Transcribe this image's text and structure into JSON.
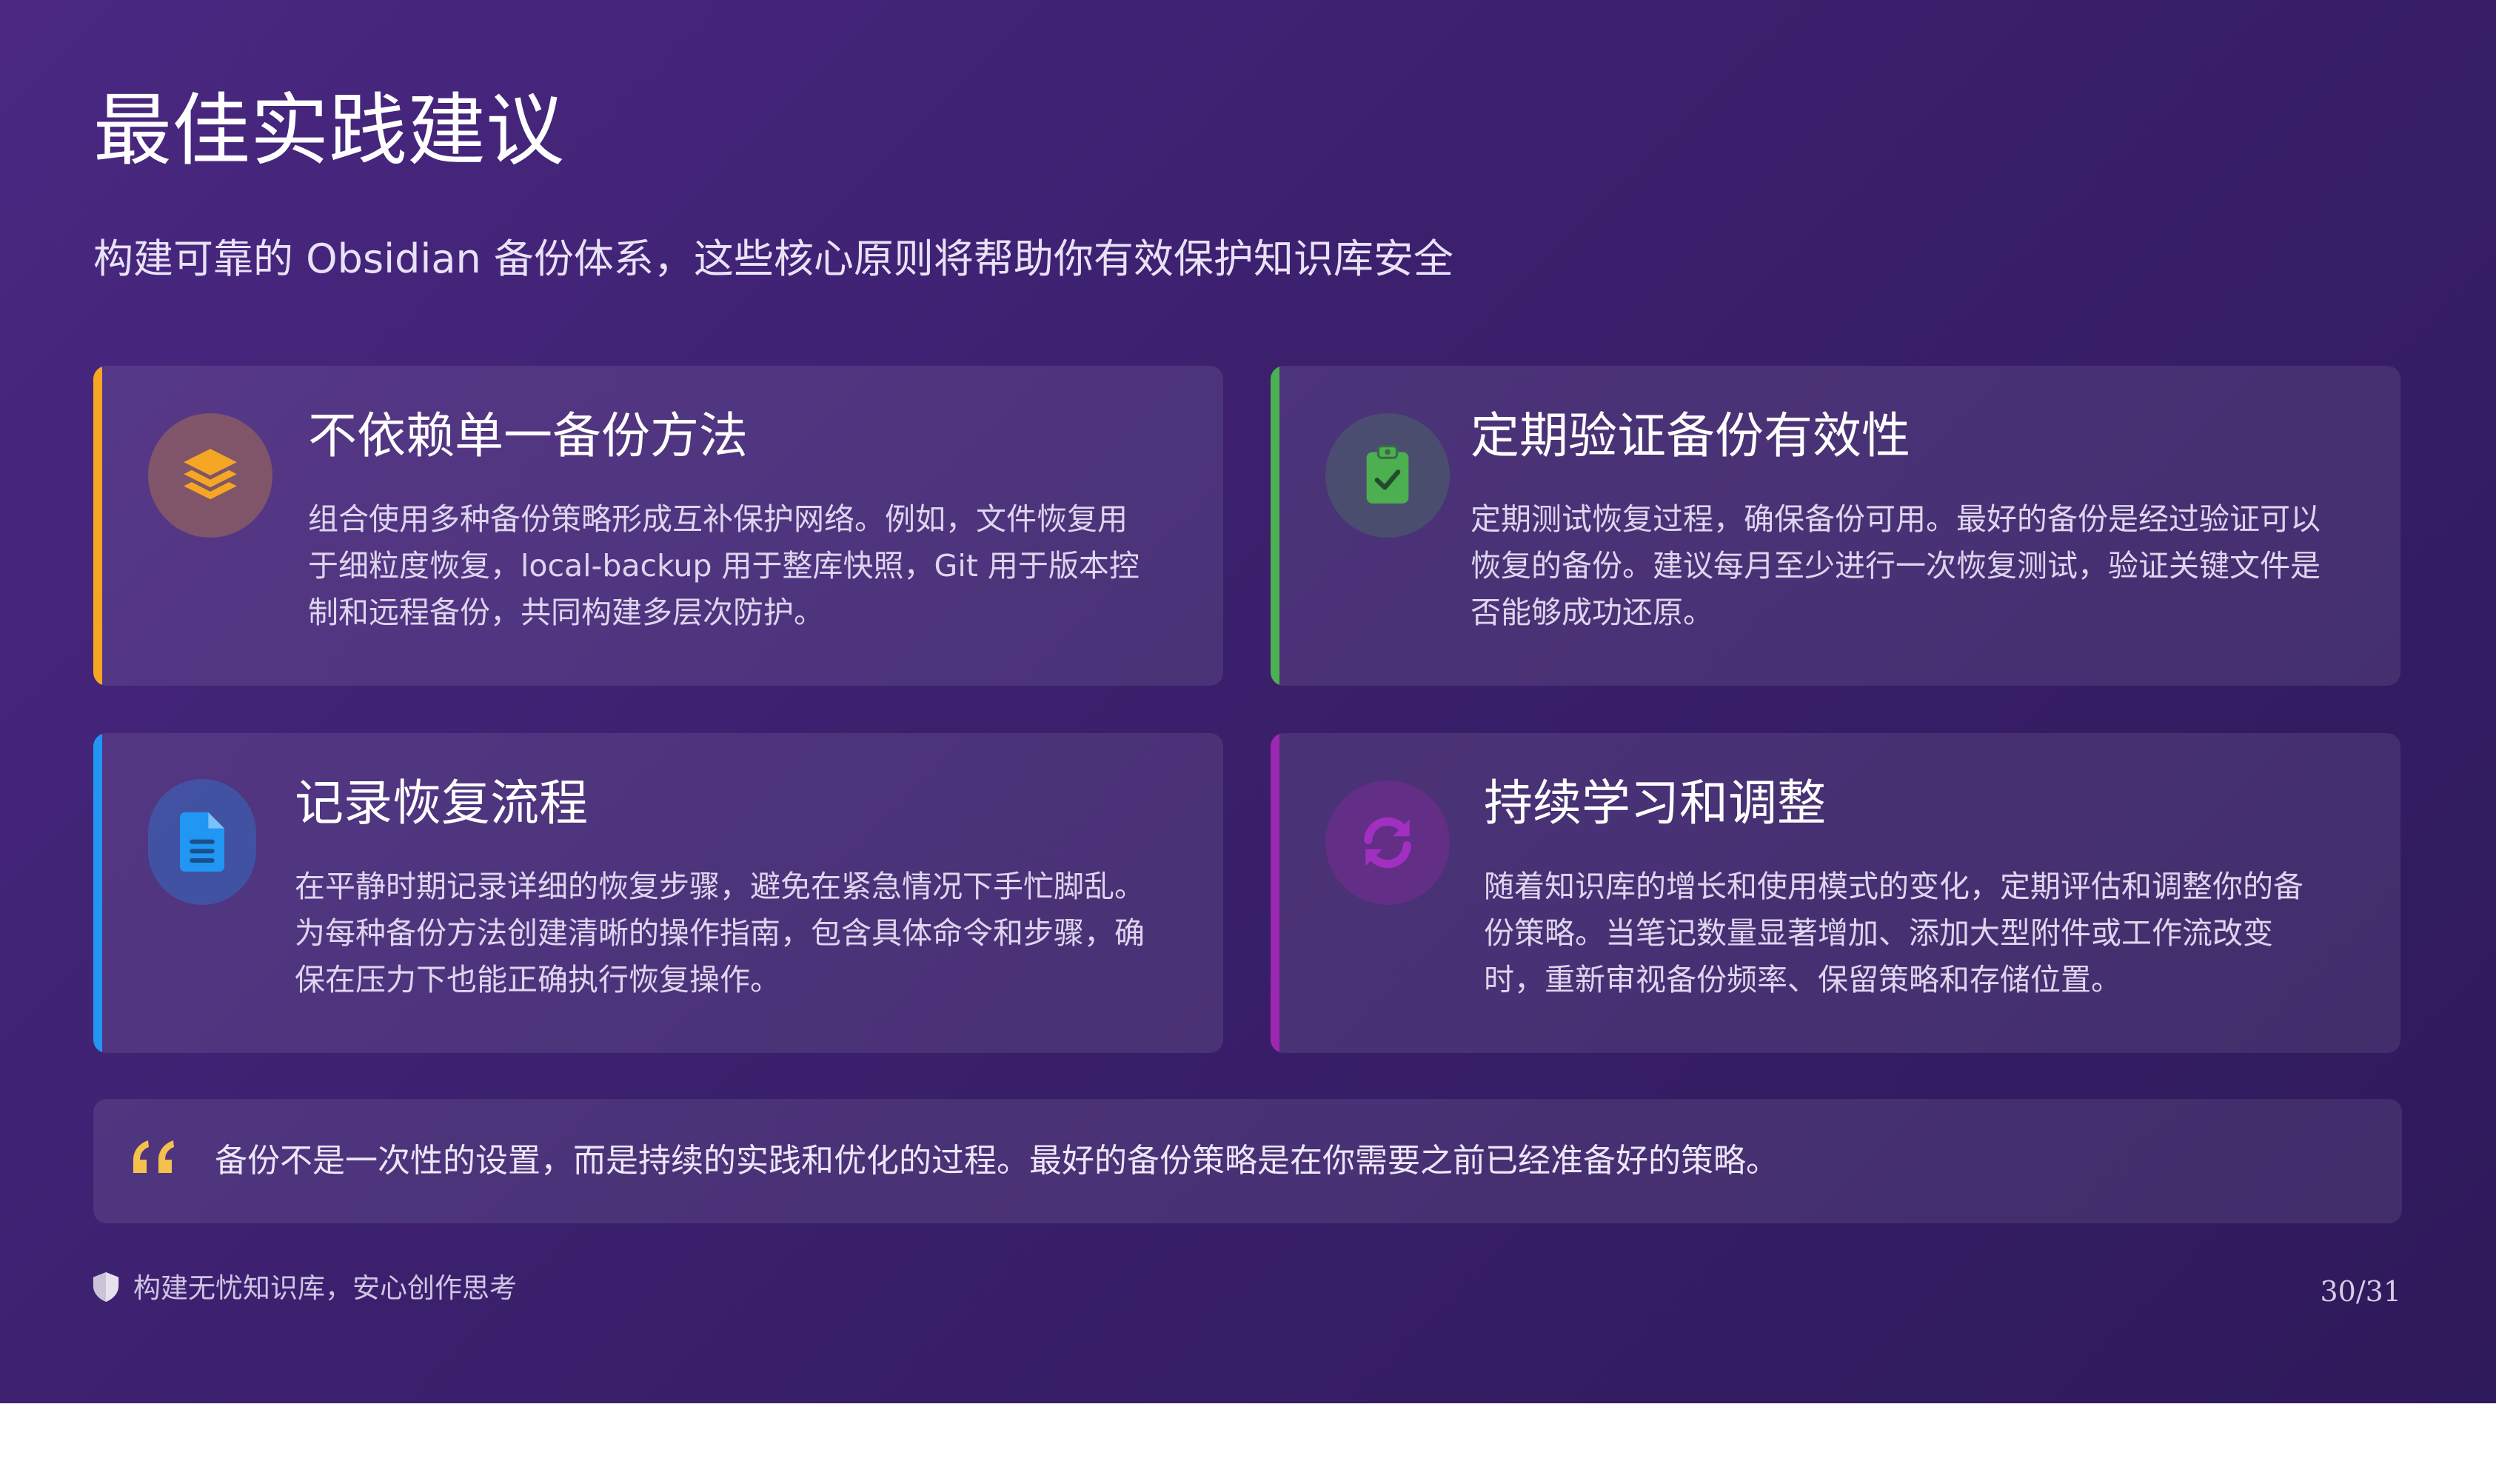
{
  "slide": {
    "title": "最佳实践建议",
    "subtitle": "构建可靠的 Obsidian  备份体系，这些核心原则将帮助你有效保护知识库安全"
  },
  "cards": [
    {
      "title": "不依赖单一备份方法",
      "body": [
        "组合使用多种备份策略形成互补保护网络。例如，文件恢复用",
        "于细粒度恢复，local-backup  用于整库快照，Git 用于版本控",
        "制和远程备份，共同构建多层次防护。"
      ],
      "icon": "layers-icon",
      "accent_color": "#f5a623"
    },
    {
      "title": "定期验证备份有效性",
      "body": [
        "定期测试恢复过程，确保备份可用。最好的备份是经过验证可以",
        "恢复的备份。建议每月至少进行一次恢复测试，验证关键文件是",
        "否能够成功还原。"
      ],
      "icon": "clipboard-check-icon",
      "accent_color": "#4caf50"
    },
    {
      "title": "记录恢复流程",
      "body": [
        "在平静时期记录详细的恢复步骤，避免在紧急情况下手忙脚乱。",
        "为每种备份方法创建清晰的操作指南，包含具体命令和步骤，确",
        "保在压力下也能正确执行恢复操作。"
      ],
      "icon": "document-icon",
      "accent_color": "#2196f3"
    },
    {
      "title": "持续学习和调整",
      "body": [
        "随着知识库的增长和使用模式的变化，定期评估和调整你的备",
        "份策略。当笔记数量显著增加、添加大型附件或工作流改变",
        "时，重新审视备份频率、保留策略和存储位置。"
      ],
      "icon": "sync-icon",
      "accent_color": "#9c27b0"
    }
  ],
  "quote": {
    "icon": "quote-icon",
    "text": "备份不是一次性的设置，而是持续的实践和优化的过程。最好的备份策略是在你需要之前已经准备好的策略。",
    "icon_color": "#f2c14e"
  },
  "footer": {
    "icon": "shield-icon",
    "text": "构建无忧知识库，安心创作思考",
    "page": "30/31"
  }
}
